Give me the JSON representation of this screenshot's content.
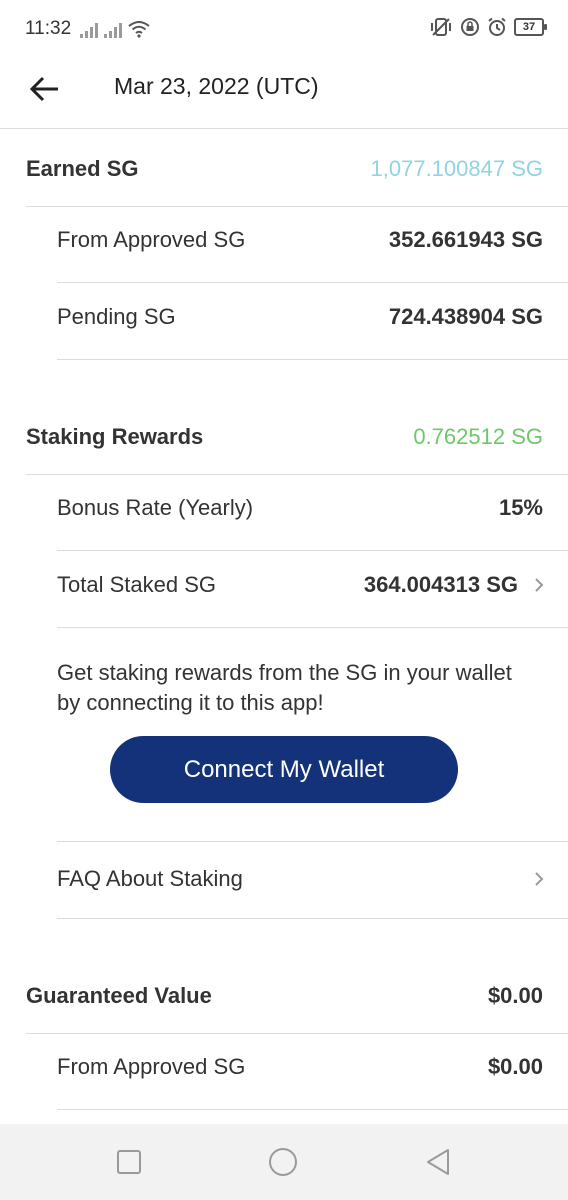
{
  "status_bar": {
    "time": "11:32",
    "battery": "37",
    "icons": [
      "signal-icon",
      "signal-icon",
      "wifi-icon",
      "vibrate-icon",
      "lock-rotation-icon",
      "alarm-icon",
      "battery-icon"
    ]
  },
  "header": {
    "title": "Mar 23, 2022 (UTC)",
    "back_icon": "arrow-left-icon"
  },
  "earned": {
    "label": "Earned SG",
    "value": "1,077.100847 SG",
    "rows": [
      {
        "label": "From Approved SG",
        "value": "352.661943 SG"
      },
      {
        "label": "Pending SG",
        "value": "724.438904 SG"
      }
    ]
  },
  "staking": {
    "label": "Staking Rewards",
    "value": "0.762512 SG",
    "bonus_rate": {
      "label": "Bonus Rate (Yearly)",
      "value": "15%"
    },
    "total_staked": {
      "label": "Total Staked SG",
      "value": "364.004313 SG"
    },
    "info": "Get staking rewards from the SG in your wallet by connecting it to this app!",
    "connect_button": "Connect My Wallet",
    "faq": "FAQ About Staking"
  },
  "guaranteed": {
    "label": "Guaranteed Value",
    "value": "$0.00",
    "rows": [
      {
        "label": "From Approved SG",
        "value": "$0.00"
      }
    ]
  },
  "colors": {
    "accent_teal": "#8fd3e4",
    "accent_green": "#6cc86a",
    "button_blue": "#14327a"
  },
  "nav": [
    "square-icon",
    "circle-icon",
    "triangle-back-icon"
  ]
}
